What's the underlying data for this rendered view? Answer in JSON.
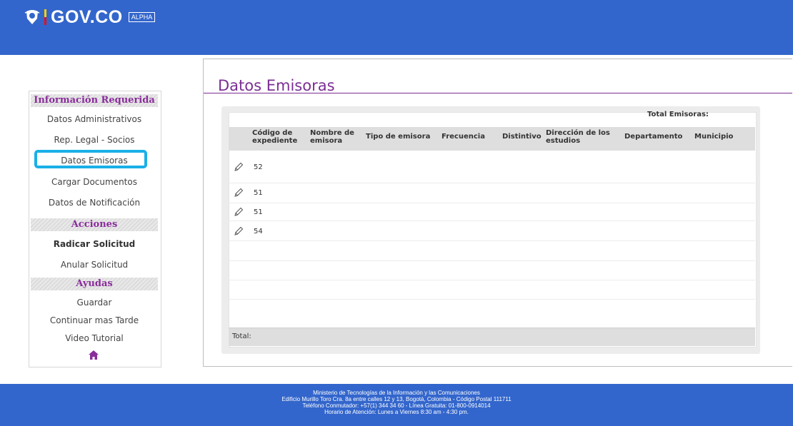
{
  "header": {
    "brand": "GOV.CO",
    "badge": "ALPHA",
    "colors": {
      "bar": "#3366cc",
      "flag_yellow": "#f8d200",
      "flag_red": "#e1111d"
    }
  },
  "sidebar": {
    "sections": [
      {
        "title": "Información Requerida",
        "items": [
          "Datos Administrativos",
          "Rep. Legal - Socios",
          "Datos Emisoras",
          "Cargar Documentos",
          "Datos de Notificación"
        ]
      },
      {
        "title": "Acciones",
        "items": [
          "Radicar Solicitud",
          "Anular Solicitud"
        ]
      },
      {
        "title": "Ayudas",
        "items": [
          "Guardar",
          "Continuar mas Tarde",
          "Video Tutorial"
        ]
      }
    ],
    "selected": "Datos Emisoras",
    "highlight_color": "#1ab0e8",
    "home_icon": "home-icon"
  },
  "main": {
    "title": "Datos Emisoras",
    "total_emisoras_label": "Total Emisoras:",
    "table": {
      "columns": [
        "Código de expediente",
        "Nombre de emisora",
        "Tipo de emisora",
        "Frecuencia",
        "Distintivo",
        "Dirección de los estudios",
        "Departamento",
        "Municipio"
      ],
      "rows": [
        {
          "codigo": "52"
        },
        {
          "codigo": "51"
        },
        {
          "codigo": "51"
        },
        {
          "codigo": "54"
        }
      ],
      "total_label": "Total:",
      "edit_icon": "pencil-icon"
    },
    "accent_color": "#7b2e93"
  },
  "footer": {
    "lines": [
      "Ministerio de Tecnologías de la Información y las Comunicaciones",
      "Edificio Murillo Toro Cra. 8a entre calles 12 y 13, Bogotá, Colombia - Código Postal 111711",
      "Teléfono Conmutador: +57(1) 344 34 60 - Línea Gratuita: 01-800-0914014",
      "Horario de Atención: Lunes a Viernes 8:30 am - 4:30 pm."
    ]
  }
}
